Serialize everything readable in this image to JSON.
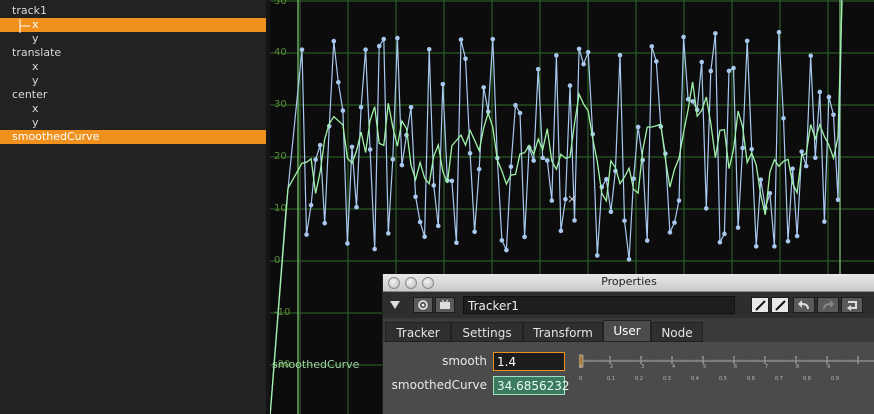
{
  "tree": {
    "items": [
      {
        "label": "track1",
        "indent": 12,
        "selected": false
      },
      {
        "label": "x",
        "indent": 32,
        "selected": true
      },
      {
        "label": "y",
        "indent": 32,
        "selected": false
      },
      {
        "label": "translate",
        "indent": 12,
        "selected": false
      },
      {
        "label": "x",
        "indent": 32,
        "selected": false
      },
      {
        "label": "y",
        "indent": 32,
        "selected": false
      },
      {
        "label": "center",
        "indent": 12,
        "selected": false
      },
      {
        "label": "x",
        "indent": 32,
        "selected": false
      },
      {
        "label": "y",
        "indent": 32,
        "selected": false
      },
      {
        "label": "smoothedCurve",
        "indent": 12,
        "selected": true
      }
    ]
  },
  "editor": {
    "y_axis_labels": [
      "50",
      "40",
      "30",
      "20",
      "10",
      "0",
      "-10",
      "-20"
    ],
    "curve_name": "smoothedCurve",
    "raw_curve_color": "#a9c8f0",
    "smoothed_curve_color": "#9ff2a8",
    "grid_color": "#2f6a28"
  },
  "properties": {
    "window_title": "Properties",
    "node_name": "Tracker1",
    "tabs": [
      "Tracker",
      "Settings",
      "Transform",
      "User",
      "Node"
    ],
    "active_tab": "User",
    "knobs": {
      "smooth_label": "smooth",
      "smooth_value": "1.4",
      "smoothed_label": "smoothedCurve",
      "smoothed_value": "34.6856232"
    },
    "slider_ticks": [
      "1",
      "2",
      "3",
      "4",
      "5",
      "6",
      "7",
      "8",
      "9"
    ],
    "slider_subticks": [
      "0",
      "0.1",
      "0.2",
      "0.3",
      "0.4",
      "0.5",
      "0.6",
      "0.7",
      "0.8",
      "0.9"
    ]
  }
}
